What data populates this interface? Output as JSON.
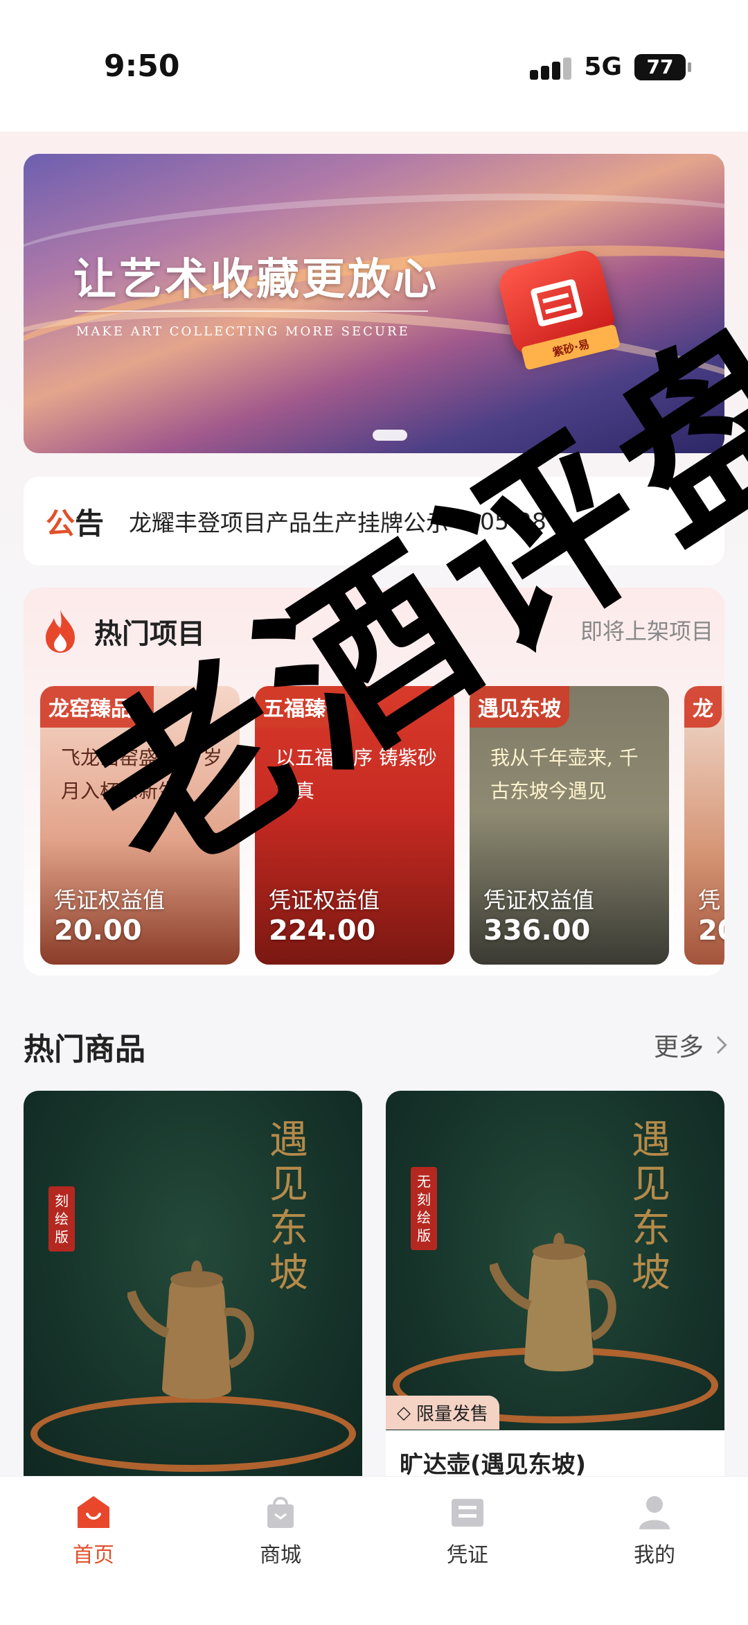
{
  "status_bar": {
    "time": "9:50",
    "network": "5G",
    "battery": "77"
  },
  "banner": {
    "title": "让艺术收藏更放心",
    "subtitle": "MAKE ART COLLECTING MORE SECURE",
    "logo_text": "紫砂·易"
  },
  "notice": {
    "tag_accent": "公",
    "tag_rest": "告",
    "text": "龙耀丰登项目产品生产挂牌公示 ·",
    "date": "05-28"
  },
  "hot_projects": {
    "title": "热门项目",
    "more": "即将上架项目",
    "items": [
      {
        "tag": "龙窑臻品Ⅱ",
        "poem": "飞龙出窑盛峥嵘 岁月入杯意新生",
        "label": "凭证权益值",
        "value": "20.00"
      },
      {
        "tag": "五福臻传",
        "poem": "以五福之序 铸紫砂本真",
        "label": "凭证权益值",
        "value": "224.00"
      },
      {
        "tag": "遇见东坡",
        "poem": "我从千年壶来, 千古东坡今遇见",
        "label": "凭证权益值",
        "value": "336.00"
      },
      {
        "tag": "龙",
        "poem": "",
        "label": "凭",
        "value": "20"
      }
    ]
  },
  "hot_goods": {
    "title": "热门商品",
    "more": "更多",
    "items": [
      {
        "stamp": "刻绘版",
        "calligraphy": "遇见东坡"
      },
      {
        "stamp": "无刻绘版",
        "calligraphy": "遇见东坡",
        "badge": "限量发售",
        "name": "旷达壶(遇见东坡)"
      }
    ]
  },
  "watermark": "老酒评盘",
  "tabbar": [
    {
      "label": "首页",
      "icon": "home-icon",
      "active": true
    },
    {
      "label": "商城",
      "icon": "shopping-bag-icon",
      "active": false
    },
    {
      "label": "凭证",
      "icon": "certificate-icon",
      "active": false
    },
    {
      "label": "我的",
      "icon": "user-icon",
      "active": false
    }
  ],
  "colors": {
    "accent": "#e0502a",
    "tab_active": "#e0502a"
  }
}
